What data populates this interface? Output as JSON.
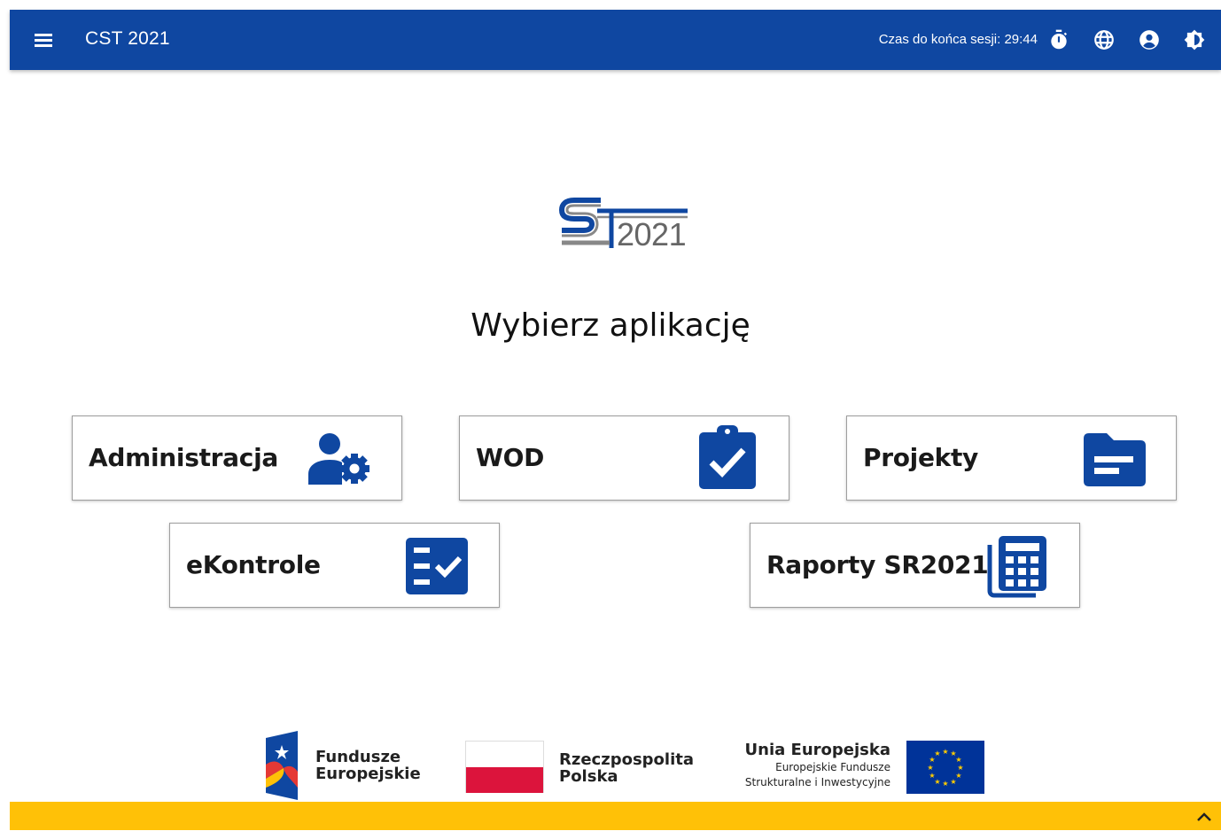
{
  "header": {
    "app_title": "CST 2021",
    "session_text": "Czas do końca sesji: 29:44",
    "icons": [
      "menu-icon",
      "timer-icon",
      "globe-icon",
      "account-icon",
      "brightness-icon"
    ],
    "color": "#0f47a1"
  },
  "logo": {
    "year": "2021"
  },
  "main": {
    "title": "Wybierz aplikację",
    "tiles": [
      {
        "label": "Administracja",
        "icon": "user-settings-icon"
      },
      {
        "label": "WOD",
        "icon": "clipboard-check-icon"
      },
      {
        "label": "Projekty",
        "icon": "folder-icon"
      },
      {
        "label": "eKontrole",
        "icon": "checklist-icon"
      },
      {
        "label": "Raporty SR2021",
        "icon": "calculator-stack-icon"
      }
    ],
    "accent": "#0f47a1"
  },
  "footer": {
    "fe": {
      "line1": "Fundusze",
      "line2": "Europejskie"
    },
    "pl": {
      "line1": "Rzeczpospolita",
      "line2": "Polska"
    },
    "eu": {
      "title": "Unia Europejska",
      "sub1": "Europejskie Fundusze",
      "sub2": "Strukturalne i Inwestycyjne"
    },
    "bar_color": "#ffc107"
  }
}
